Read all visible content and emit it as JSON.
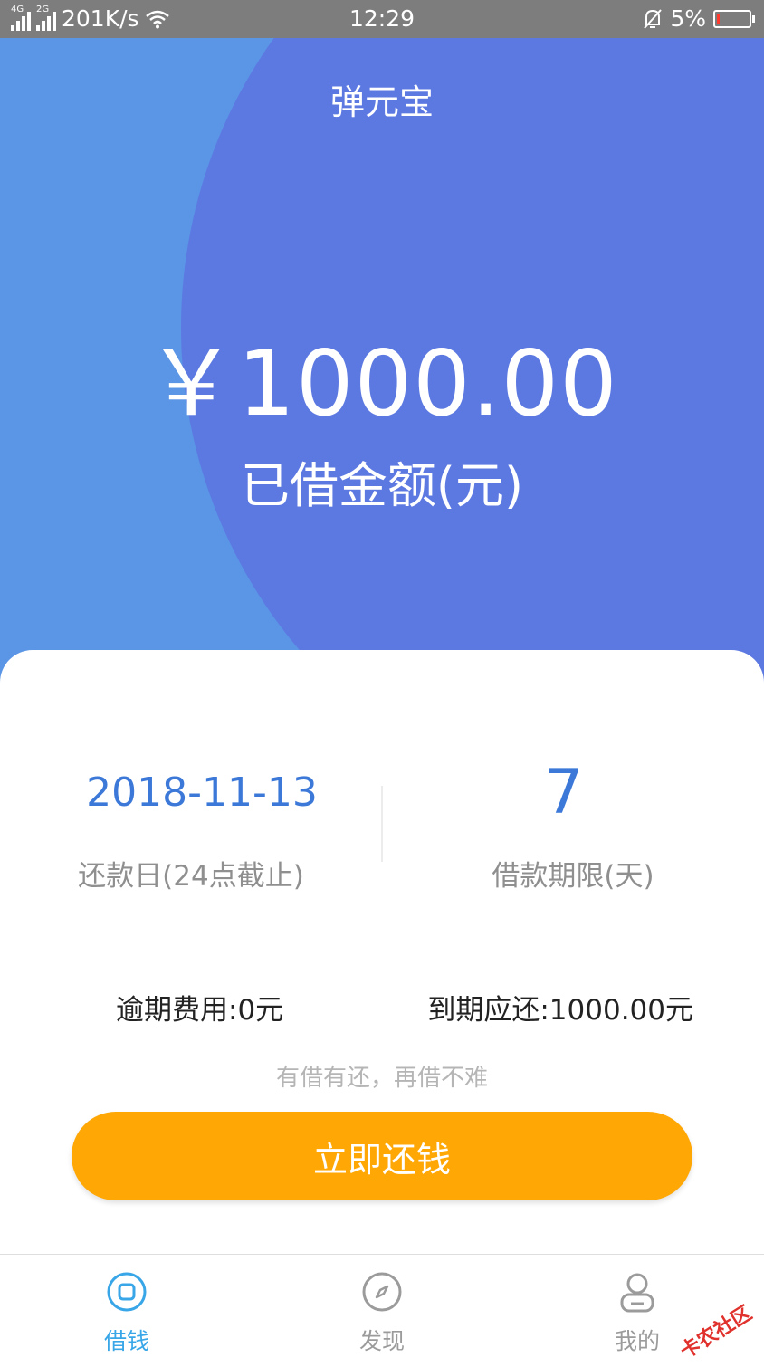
{
  "status_bar": {
    "net_tag_1": "4G",
    "net_tag_2": "2G",
    "speed": "201K/s",
    "time": "12:29",
    "battery_percent_text": "5%",
    "battery_level": 0.05
  },
  "header": {
    "title": "弹元宝"
  },
  "loan": {
    "amount": "￥1000.00",
    "amount_label": "已借金额(元)",
    "due_date": "2018-11-13",
    "due_date_label": "还款日(24点截止)",
    "term": "7",
    "term_label": "借款期限(天)",
    "overdue_fee": "逾期费用:0元",
    "due_amount": "到期应还:1000.00元",
    "slogan": "有借有还，再借不难",
    "repay_button_label": "立即还钱"
  },
  "bottom_nav": {
    "items": [
      {
        "label": "借钱",
        "icon": "borrow-icon",
        "active": true
      },
      {
        "label": "发现",
        "icon": "compass-icon",
        "active": false
      },
      {
        "label": "我的",
        "icon": "user-icon",
        "active": false
      }
    ]
  },
  "watermark": "卡农社区",
  "colors": {
    "hero_bg": "#5a95e6",
    "hero_blob": "#5c79e2",
    "accent_blue": "#3b78d8",
    "button_orange": "#ffa705",
    "nav_active": "#39a6e8",
    "nav_inactive": "#9b9b9b"
  }
}
